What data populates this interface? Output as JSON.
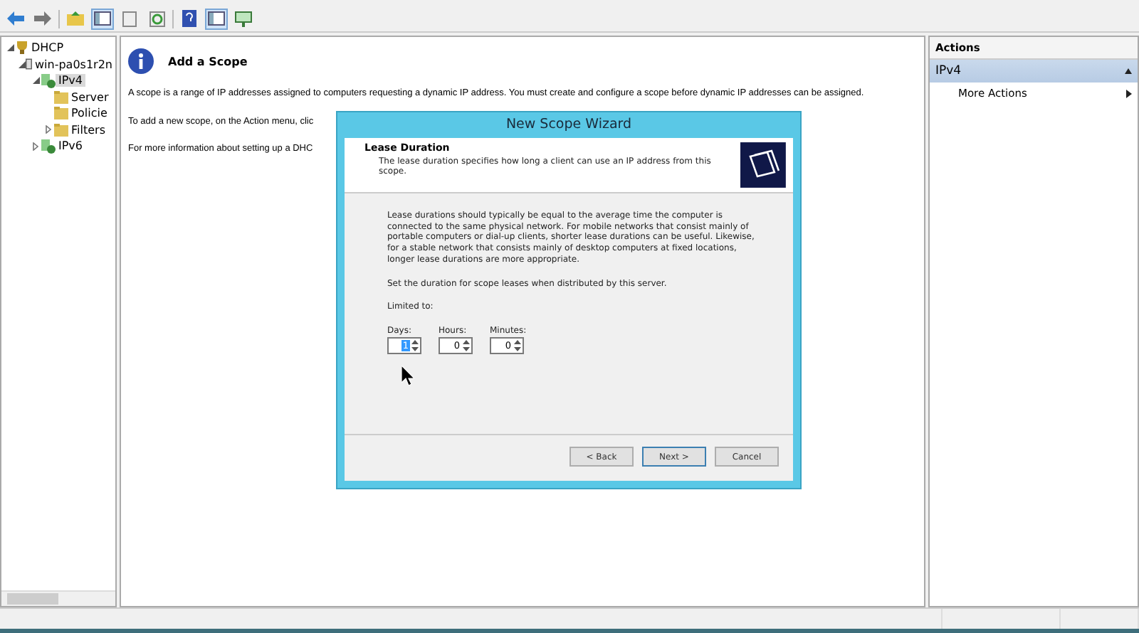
{
  "toolbar": {
    "buttons": [
      {
        "kind": "back"
      },
      {
        "kind": "forward"
      },
      {
        "kind": "up"
      },
      {
        "kind": "panel"
      },
      {
        "kind": "page"
      },
      {
        "kind": "refresh"
      },
      {
        "kind": "help"
      },
      {
        "kind": "panel"
      },
      {
        "kind": "monitor"
      }
    ]
  },
  "tree": [
    {
      "label": "DHCP",
      "kind": "root",
      "expanded": true,
      "children": [
        {
          "label": "win-pa0s1r2n",
          "kind": "server",
          "expanded": true,
          "children": [
            {
              "label": "IPv4",
              "kind": "protocol",
              "expanded": true,
              "selected": true,
              "children": [
                {
                  "label": "Server",
                  "kind": "folder",
                  "selected": false
                },
                {
                  "label": "Policie",
                  "kind": "folder",
                  "selected": false
                },
                {
                  "label": "Filters",
                  "kind": "folder",
                  "expanded": false,
                  "selected": false
                }
              ]
            },
            {
              "label": "IPv6",
              "kind": "protocol",
              "expanded": false,
              "selected": false
            }
          ]
        }
      ]
    }
  ],
  "content": {
    "title": "Add a Scope",
    "paragraphs": [
      "A scope is a range of IP addresses assigned to computers requesting a dynamic IP address. You must create and configure a scope before dynamic IP addresses can be assigned.",
      "To add a new scope, on the Action menu, clic",
      "For more information about setting up a DHC"
    ]
  },
  "actions": {
    "header": "Actions",
    "section": "IPv4",
    "items": [
      "More Actions"
    ]
  },
  "dialog": {
    "title": "New Scope Wizard",
    "heading": "Lease Duration",
    "subheading": "The lease duration specifies how long a client can use an IP address from this scope.",
    "body": "Lease durations should typically be equal to the average time the computer is connected to the same physical network. For mobile networks that consist mainly of portable computers or dial-up clients, shorter lease durations can be useful. Likewise, for a stable network that consists mainly of desktop computers at fixed locations, longer lease durations are more appropriate.",
    "prompt": "Set the duration for scope leases when distributed by this server.",
    "limit_label": "Limited to:",
    "fields": [
      {
        "label": "Days:",
        "value": "1",
        "selected": true
      },
      {
        "label": "Hours:",
        "value": "0",
        "selected": false
      },
      {
        "label": "Minutes:",
        "value": "0",
        "selected": false
      }
    ],
    "buttons": [
      {
        "label": "< Back",
        "default": false
      },
      {
        "label": "Next >",
        "default": true
      },
      {
        "label": "Cancel",
        "default": false
      }
    ]
  }
}
